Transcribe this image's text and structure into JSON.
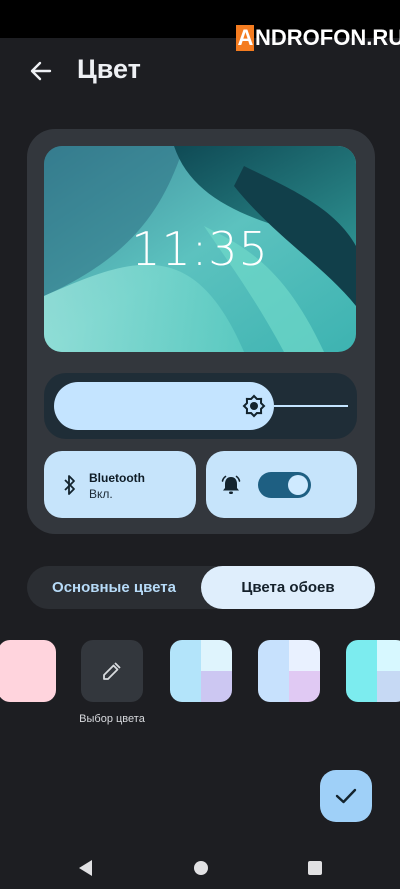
{
  "watermark": {
    "first_letter": "A",
    "rest": "NDROFON.RU"
  },
  "header": {
    "title": "Цвет",
    "back_icon": "arrow-left-icon"
  },
  "preview": {
    "clock": "11:35",
    "brightness_level": 0.7,
    "bluetooth": {
      "title": "Bluetooth",
      "status": "Вкл."
    },
    "alarm_toggle_on": true
  },
  "tabs": {
    "basic": "Основные цвета",
    "wallpaper": "Цвета обоев",
    "selected": "wallpaper"
  },
  "swatches": {
    "picker_label": "Выбор цвета",
    "colors": {
      "pink": "#ffd4dd",
      "a": [
        "#b3e4fa",
        "#dff4fd",
        "#b3e4fa",
        "#ccc7f2"
      ],
      "b": [
        "#c7e1fd",
        "#e9f1ff",
        "#c7e1fd",
        "#e0c9f3"
      ],
      "c": [
        "#7cecef",
        "#d7f8ff",
        "#7cecef",
        "#c6d9f4"
      ]
    }
  },
  "fab": {
    "icon": "check-icon"
  },
  "navbar": {
    "back": "nav-back-icon",
    "home": "nav-home-icon",
    "recents": "nav-recents-icon"
  },
  "colors": {
    "background": "#1d1e22",
    "accent": "#9fd0f8",
    "toggle": "#1e5f82"
  }
}
